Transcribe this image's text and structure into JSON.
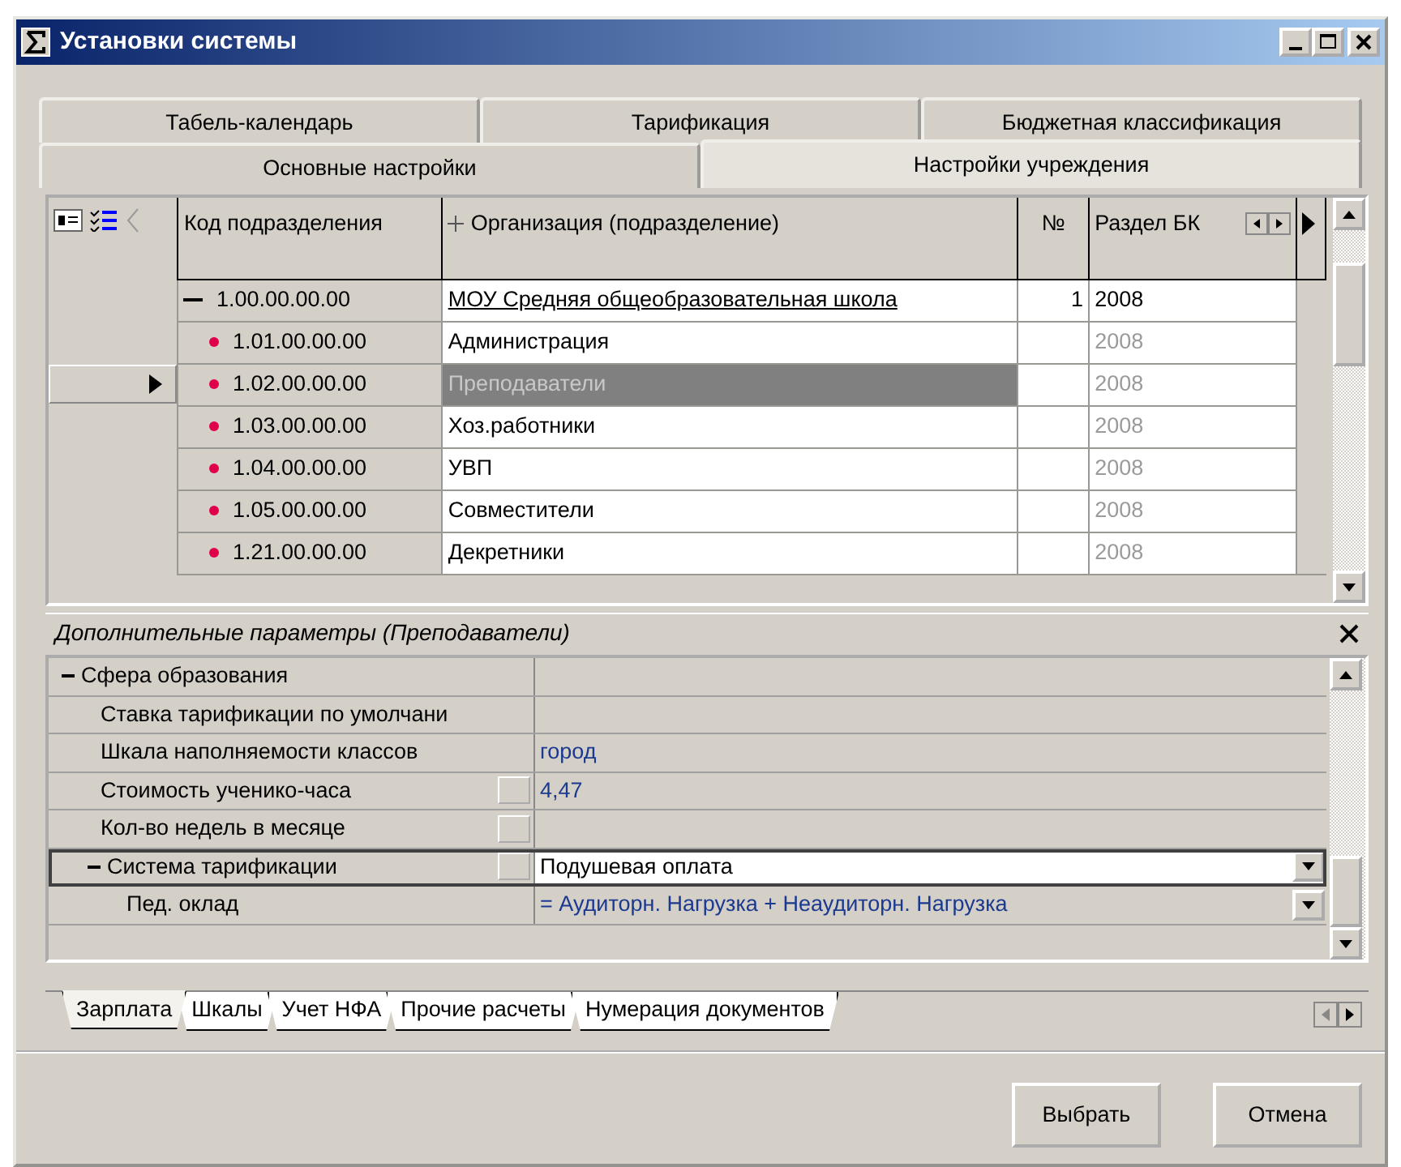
{
  "window": {
    "title": "Установки системы"
  },
  "tab_rows": [
    [
      {
        "label": "Табель-календарь",
        "selected": false
      },
      {
        "label": "Тарификация",
        "selected": false
      },
      {
        "label": "Бюджетная классификация",
        "selected": false
      }
    ],
    [
      {
        "label": "Основные настройки",
        "selected": false
      },
      {
        "label": "Настройки учреждения",
        "selected": true
      }
    ]
  ],
  "grid": {
    "columns": [
      "Код подразделения",
      "Организация (подразделение)",
      "№",
      "Раздел БК"
    ],
    "rows": [
      {
        "code": "1.00.00.00.00",
        "name": "МОУ Средняя общеобразовательная школа",
        "number": "1",
        "section": "2008",
        "section_inherited": false,
        "selected": false,
        "expanded": true,
        "children": [
          {
            "code": "1.01.00.00.00",
            "name": "Администрация",
            "section": "2008",
            "section_inherited": true,
            "selected": false
          },
          {
            "code": "1.02.00.00.00",
            "name": "Преподаватели",
            "section": "2008",
            "section_inherited": true,
            "selected": true
          },
          {
            "code": "1.03.00.00.00",
            "name": "Хоз.работники",
            "section": "2008",
            "section_inherited": true,
            "selected": false
          },
          {
            "code": "1.04.00.00.00",
            "name": "УВП",
            "section": "2008",
            "section_inherited": true,
            "selected": false
          },
          {
            "code": "1.05.00.00.00",
            "name": "Совместители",
            "section": "2008",
            "section_inherited": true,
            "selected": false
          },
          {
            "code": "1.21.00.00.00",
            "name": "Декретники",
            "section": "2008",
            "section_inherited": true,
            "selected": false
          }
        ]
      }
    ]
  },
  "properties": {
    "title": "Дополнительные параметры (Преподаватели)",
    "rows": [
      {
        "label": "Сфера образования",
        "selected": false,
        "expanded": true,
        "children": [
          {
            "label": "Ставка тарификации по умолчани",
            "kind": "text",
            "selected": false
          },
          {
            "label": "Шкала наполняемости классов",
            "value": "город",
            "kind": "text",
            "selected": false
          },
          {
            "label": "Стоимость ученико-часа",
            "value": "4,47",
            "kind": "text",
            "has_button": true,
            "selected": false
          },
          {
            "label": "Кол-во недель в месяце",
            "kind": "text",
            "has_button": true,
            "selected": false
          },
          {
            "label": "Система тарификации",
            "value": "Подушевая оплата",
            "kind": "dropdown",
            "has_button": true,
            "selected": true,
            "expanded": true,
            "children": [
              {
                "label": "Пед. оклад",
                "value": "= Аудиторн. Нагрузка + Неаудиторн. Нагрузка",
                "kind": "dropdown",
                "selected": false
              }
            ]
          }
        ]
      }
    ]
  },
  "bottom_tabs": [
    {
      "label": "Зарплата",
      "selected": true
    },
    {
      "label": "Шкалы",
      "selected": false
    },
    {
      "label": "Учет НФА",
      "selected": false
    },
    {
      "label": "Прочие расчеты",
      "selected": false
    },
    {
      "label": "Нумерация документов",
      "selected": false
    }
  ],
  "buttons": [
    "Выбрать",
    "Отмена"
  ]
}
